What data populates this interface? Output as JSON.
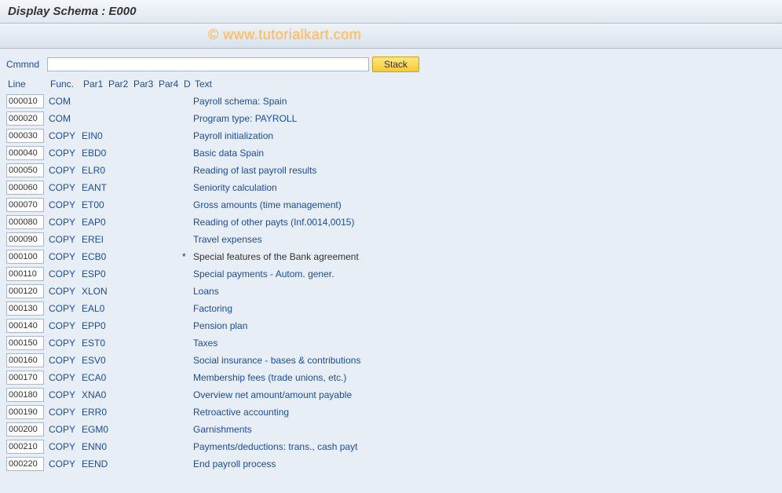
{
  "title": "Display Schema : E000",
  "watermark": "© www.tutorialkart.com",
  "cmd": {
    "label": "Cmmnd",
    "value": "",
    "stack_label": "Stack"
  },
  "headers": {
    "line": "Line",
    "func": "Func.",
    "par1": "Par1",
    "par2": "Par2",
    "par3": "Par3",
    "par4": "Par4",
    "d": "D",
    "text": "Text"
  },
  "rows": [
    {
      "line": "000010",
      "func": "COM",
      "par1": "",
      "d": "",
      "text": "Payroll schema: Spain",
      "link": true
    },
    {
      "line": "000020",
      "func": "COM",
      "par1": "",
      "d": "",
      "text": "Program type: PAYROLL",
      "link": true
    },
    {
      "line": "000030",
      "func": "COPY",
      "par1": "EIN0",
      "d": "",
      "text": "Payroll initialization",
      "link": true
    },
    {
      "line": "000040",
      "func": "COPY",
      "par1": "EBD0",
      "d": "",
      "text": "Basic data Spain",
      "link": true
    },
    {
      "line": "000050",
      "func": "COPY",
      "par1": "ELR0",
      "d": "",
      "text": "Reading of last payroll results",
      "link": true
    },
    {
      "line": "000060",
      "func": "COPY",
      "par1": "EANT",
      "d": "",
      "text": "Seniority calculation",
      "link": true
    },
    {
      "line": "000070",
      "func": "COPY",
      "par1": "ET00",
      "d": "",
      "text": "Gross amounts (time management)",
      "link": true
    },
    {
      "line": "000080",
      "func": "COPY",
      "par1": "EAP0",
      "d": "",
      "text": "Reading of other payts (Inf.0014,0015)",
      "link": true
    },
    {
      "line": "000090",
      "func": "COPY",
      "par1": "EREI",
      "d": "",
      "text": "Travel expenses",
      "link": true
    },
    {
      "line": "000100",
      "func": "COPY",
      "par1": "ECB0",
      "d": "*",
      "text": "Special features of the Bank agreement",
      "link": false
    },
    {
      "line": "000110",
      "func": "COPY",
      "par1": "ESP0",
      "d": "",
      "text": "Special payments - Autom. gener.",
      "link": true
    },
    {
      "line": "000120",
      "func": "COPY",
      "par1": "XLON",
      "d": "",
      "text": "Loans",
      "link": true
    },
    {
      "line": "000130",
      "func": "COPY",
      "par1": "EAL0",
      "d": "",
      "text": "Factoring",
      "link": true
    },
    {
      "line": "000140",
      "func": "COPY",
      "par1": "EPP0",
      "d": "",
      "text": "Pension plan",
      "link": true
    },
    {
      "line": "000150",
      "func": "COPY",
      "par1": "EST0",
      "d": "",
      "text": "Taxes",
      "link": true
    },
    {
      "line": "000160",
      "func": "COPY",
      "par1": "ESV0",
      "d": "",
      "text": "Social insurance - bases & contributions",
      "link": true
    },
    {
      "line": "000170",
      "func": "COPY",
      "par1": "ECA0",
      "d": "",
      "text": "Membership fees (trade unions, etc.)",
      "link": true
    },
    {
      "line": "000180",
      "func": "COPY",
      "par1": "XNA0",
      "d": "",
      "text": "Overview net amount/amount payable",
      "link": true
    },
    {
      "line": "000190",
      "func": "COPY",
      "par1": "ERR0",
      "d": "",
      "text": "Retroactive accounting",
      "link": true
    },
    {
      "line": "000200",
      "func": "COPY",
      "par1": "EGM0",
      "d": "",
      "text": "Garnishments",
      "link": true
    },
    {
      "line": "000210",
      "func": "COPY",
      "par1": "ENN0",
      "d": "",
      "text": "Payments/deductions: trans., cash payt",
      "link": true
    },
    {
      "line": "000220",
      "func": "COPY",
      "par1": "EEND",
      "d": "",
      "text": "End payroll process",
      "link": true
    }
  ]
}
